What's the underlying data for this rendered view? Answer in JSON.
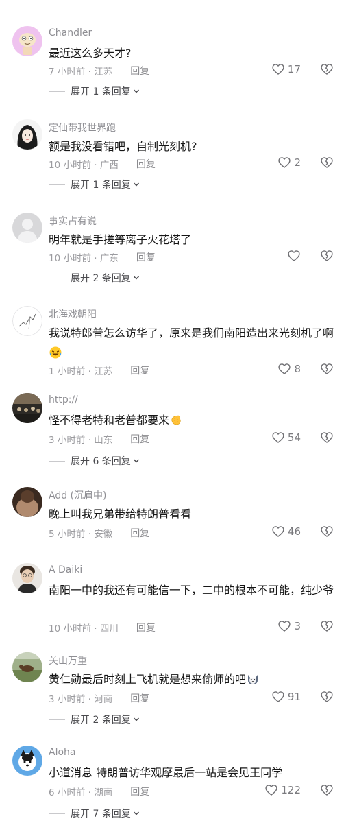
{
  "reply_label": "回复",
  "comments": [
    {
      "username": "Chandler",
      "text": "最近这么多天才?",
      "meta": "7 小时前 · 江苏",
      "likes": "17",
      "expand": "展开 1 条回复"
    },
    {
      "username": "定仙带我世界跑",
      "text": "额是我没看错吧，自制光刻机?",
      "meta": "10 小时前 · 广西",
      "likes": "2",
      "expand": "展开 1 条回复"
    },
    {
      "username": "事实占有说",
      "text": "明年就是手搓等离子火花塔了",
      "meta": "10 小时前 · 广东",
      "likes": "",
      "expand": "展开 2 条回复"
    },
    {
      "username": "北海戏朝阳",
      "text": "我说特郎普怎么访华了，原来是我们南阳造出来光刻机了啊",
      "meta": "1 小时前 · 江苏",
      "likes": "8",
      "expand": ""
    },
    {
      "username": "http://",
      "text": "怪不得老特和老普都要来",
      "meta": "3 小时前 · 山东",
      "likes": "54",
      "expand": "展开 6 条回复"
    },
    {
      "username": "Add (沉肩中)",
      "text": "晚上叫我兄弟带给特朗普看看",
      "meta": "5 小时前 · 安徽",
      "likes": "46",
      "expand": ""
    },
    {
      "username": "A Daiki",
      "text": "南阳一中的我还有可能信一下，二中的根本不可能，纯少爷",
      "meta": "10 小时前 · 四川",
      "likes": "3",
      "expand": ""
    },
    {
      "username": "关山万重",
      "text": "黄仁勋最后时刻上飞机就是想来偷师的吧",
      "meta": "3 小时前 · 河南",
      "likes": "91",
      "expand": "展开 2 条回复"
    },
    {
      "username": "Aloha",
      "text": "小道消息 特朗普访华观摩最后一站是会见王同学",
      "meta": "6 小时前 · 湖南",
      "likes": "122",
      "expand": "展开 7 条回复"
    }
  ],
  "icons": {
    "like": "heart-outline-icon",
    "dislike": "broken-heart-icon",
    "expand": "chevron-down-icon",
    "emoji_4": "laughing-crying-emoji",
    "emoji_5": "clapping-hands-emoji",
    "emoji_8": "husky-emoji"
  }
}
